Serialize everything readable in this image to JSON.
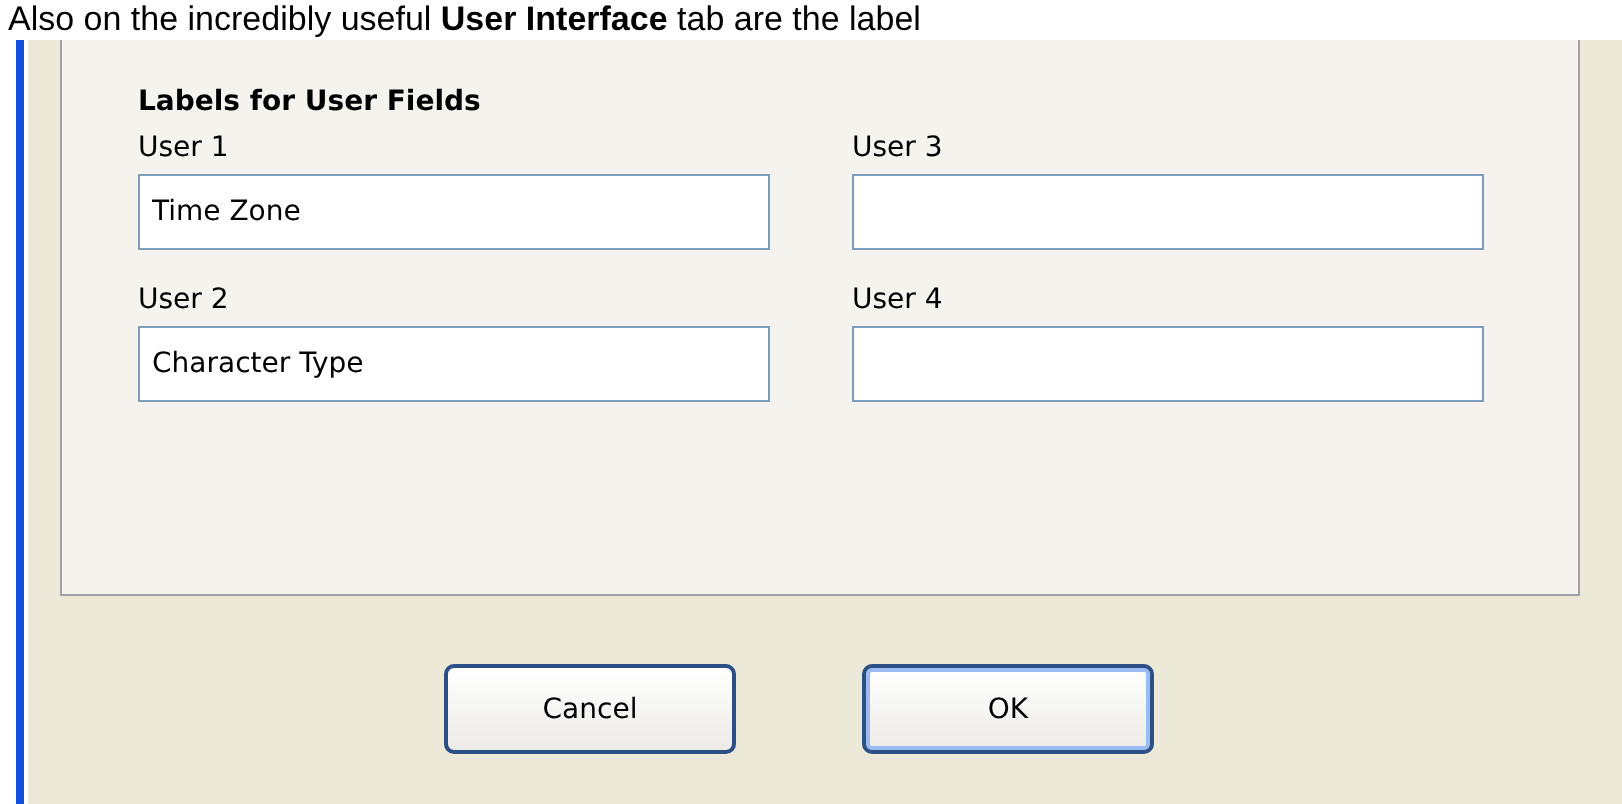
{
  "caption": "Also on the incredibly useful **User Interface** tab are the label",
  "group": {
    "title": "Labels for User Fields",
    "fields": [
      {
        "label": "User 1",
        "value": "Time Zone"
      },
      {
        "label": "User 3"
      },
      {
        "label": "User 2",
        "value": "Character Type"
      },
      {
        "label": "User 4"
      }
    ]
  },
  "buttons": [
    {
      "label": "Cancel",
      "default": false
    },
    {
      "label": "OK",
      "default": true
    }
  ]
}
